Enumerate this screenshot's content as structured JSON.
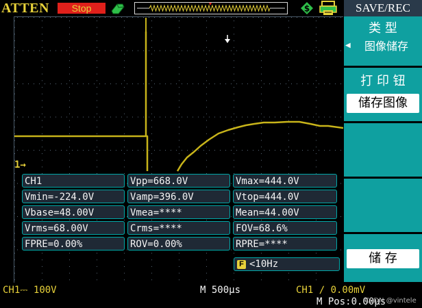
{
  "header": {
    "brand": "ATTEN",
    "run_status": "Stop"
  },
  "colors": {
    "trace": "#c8b41a",
    "accent_yellow": "#e8d23a",
    "menu_teal": "#0fa0a0",
    "panel_cyan": "#00a8a8",
    "stop_red": "#e0201b"
  },
  "measurements": {
    "channel": "CH1",
    "rows": [
      [
        "",
        "Vpp=668.0V",
        "Vmax=444.0V"
      ],
      [
        "Vmin=-224.0V",
        "Vamp=396.0V",
        "Vtop=444.0V"
      ],
      [
        "Vbase=48.00V",
        "Vmea=****",
        "Mean=44.00V"
      ],
      [
        "Vrms=68.00V",
        "Crms=****",
        "FOV=68.6%"
      ],
      [
        "FPRE=0.00%",
        "ROV=0.00%",
        "RPRE=****"
      ]
    ]
  },
  "frequency": {
    "icon": "F",
    "value": "<10Hz"
  },
  "status_bar": {
    "ch1_scale": "CH1⎓ 100V",
    "timebase": "M 500μs",
    "trigger": "CH1 ∕ 0.00mV",
    "position": "M Pos:0.00μs",
    "watermark": "CSDN @vintele"
  },
  "menu": {
    "title": "SAVE/REC",
    "type_label": "类 型",
    "type_value": "图像储存",
    "print_key_label": "打 印 钮",
    "print_key_value": "储存图像",
    "save_label": "储 存"
  }
}
